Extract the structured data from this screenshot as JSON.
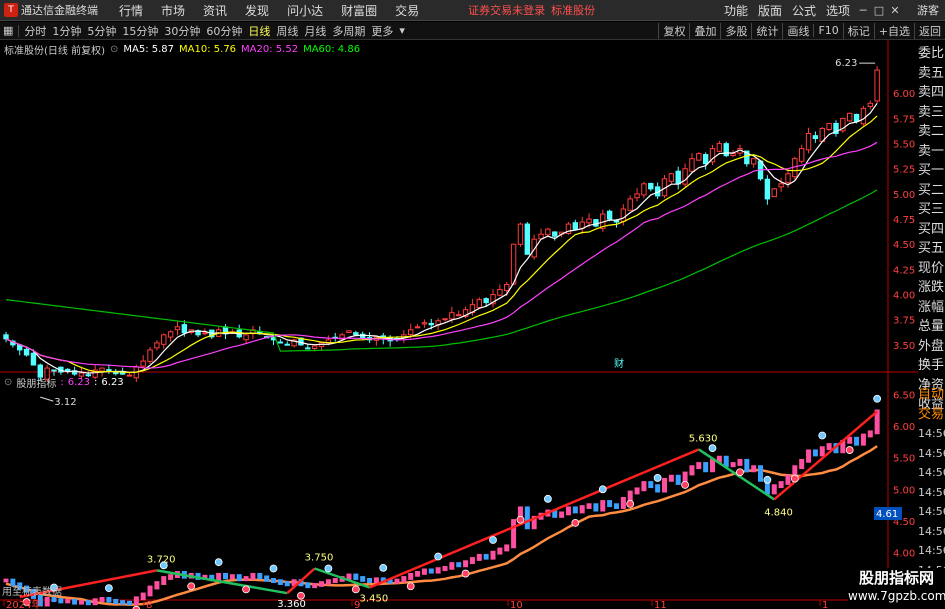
{
  "window": {
    "title": "通达信金融终端",
    "menus": [
      "行情",
      "市场",
      "资讯",
      "发现",
      "问小达",
      "财富圈",
      "交易"
    ],
    "alert": "证券交易未登录",
    "stock_name": "标准股份",
    "right_menus": [
      "功能",
      "版面",
      "公式",
      "选项"
    ],
    "guest": "游客"
  },
  "toolbar": {
    "periods": [
      "分时",
      "1分钟",
      "5分钟",
      "15分钟",
      "30分钟",
      "60分钟",
      "日线",
      "周线",
      "月线",
      "多周期",
      "更多"
    ],
    "active": "日线",
    "right_buttons": [
      "复权",
      "叠加",
      "多股",
      "统计",
      "画线",
      "F10",
      "标记",
      "+自选",
      "返回"
    ]
  },
  "main_chart": {
    "title": "标准股份(日线 前复权)",
    "ma": [
      {
        "label": "MA5: 5.87",
        "color": "#ffffff"
      },
      {
        "label": "MA10: 5.76",
        "color": "#ffff00"
      },
      {
        "label": "MA20: 5.52",
        "color": "#ff40ff"
      },
      {
        "label": "MA60: 4.86",
        "color": "#00ff00"
      }
    ],
    "high_label": "6.23",
    "low_label": "3.12",
    "event_label": "财"
  },
  "indicator": {
    "name": "股朋指标",
    "value1": "6.23",
    "value2": "6.23",
    "labels": [
      "3.720",
      "3.360",
      "3.750",
      "3.450",
      "5.630",
      "4.840"
    ],
    "current": "4.61",
    "footer_note": "用至标表数据"
  },
  "side_panel": [
    "委比",
    "卖五",
    "卖四",
    "卖三",
    "卖二",
    "卖一",
    "买一",
    "买二",
    "买三",
    "买四",
    "买五",
    "现价",
    "涨跌",
    "涨幅",
    "总量",
    "外盘",
    "换手",
    "净资",
    "收益"
  ],
  "side_panel2": [
    "自动",
    "交易",
    "14:56",
    "14:56",
    "14:56",
    "14:56",
    "14:56",
    "14:56",
    "14:56",
    "14:56",
    "14:56"
  ],
  "watermark": {
    "line1": "股朋指标网",
    "line2": "www.7gpzb.com"
  },
  "chart_data": [
    {
      "type": "candlestick",
      "title": "标准股份(日线 前复权)",
      "y_ticks": [
        "6.00",
        "5.75",
        "5.50",
        "5.25",
        "5.00",
        "4.75",
        "4.50",
        "4.25",
        "4.00",
        "3.75",
        "3.50"
      ],
      "ylim": [
        3.35,
        6.35
      ],
      "x_ticks": [
        "2024年",
        "8",
        "9",
        "10",
        "11",
        "1"
      ],
      "close": [
        3.56,
        3.5,
        3.45,
        3.4,
        3.3,
        3.18,
        3.27,
        3.25,
        3.23,
        3.24,
        3.21,
        3.22,
        3.2,
        3.25,
        3.27,
        3.24,
        3.22,
        3.21,
        3.2,
        3.28,
        3.34,
        3.45,
        3.52,
        3.6,
        3.63,
        3.68,
        3.62,
        3.65,
        3.6,
        3.62,
        3.58,
        3.65,
        3.61,
        3.63,
        3.58,
        3.6,
        3.65,
        3.61,
        3.57,
        3.55,
        3.52,
        3.5,
        3.55,
        3.5,
        3.47,
        3.49,
        3.52,
        3.55,
        3.57,
        3.6,
        3.64,
        3.6,
        3.57,
        3.55,
        3.58,
        3.56,
        3.54,
        3.56,
        3.6,
        3.65,
        3.68,
        3.72,
        3.7,
        3.74,
        3.76,
        3.82,
        3.8,
        3.85,
        3.9,
        3.95,
        3.92,
        4.0,
        4.05,
        4.1,
        4.5,
        4.7,
        4.4,
        4.55,
        4.6,
        4.65,
        4.58,
        4.62,
        4.7,
        4.65,
        4.72,
        4.75,
        4.68,
        4.8,
        4.75,
        4.72,
        4.85,
        4.95,
        5.0,
        5.1,
        5.05,
        4.98,
        5.15,
        5.2,
        5.1,
        5.25,
        5.35,
        5.4,
        5.3,
        5.45,
        5.5,
        5.38,
        5.4,
        5.45,
        5.3,
        5.35,
        5.15,
        4.95,
        5.05,
        5.1,
        5.2,
        5.35,
        5.45,
        5.6,
        5.55,
        5.65,
        5.7,
        5.6,
        5.75,
        5.8,
        5.72,
        5.85,
        5.9,
        6.23
      ],
      "series": [
        {
          "name": "MA5",
          "color": "#ffffff"
        },
        {
          "name": "MA10",
          "color": "#ffff00"
        },
        {
          "name": "MA20",
          "color": "#ff40ff"
        },
        {
          "name": "MA60",
          "color": "#00ff00"
        }
      ]
    },
    {
      "type": "line",
      "title": "股朋指标",
      "y_ticks": [
        "6.50",
        "6.00",
        "5.50",
        "5.00",
        "4.50",
        "4.00"
      ],
      "ylim": [
        3.3,
        6.6
      ],
      "peak_labels": [
        "3.720",
        "3.750",
        "5.630"
      ],
      "trough_labels": [
        "3.360",
        "3.450",
        "4.840"
      ]
    }
  ]
}
